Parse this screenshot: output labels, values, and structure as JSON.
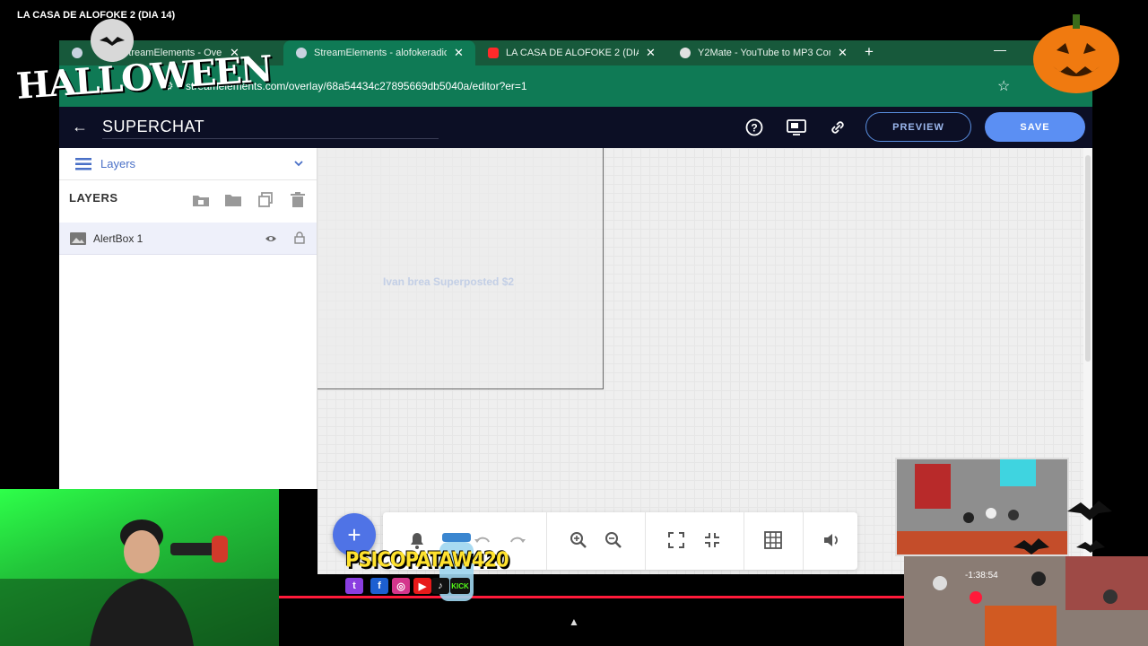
{
  "stream_title": "LA CASA DE ALOFOKE 2 (DIA 14)",
  "browser": {
    "tabs": [
      {
        "label": "StreamElements - Overlays",
        "icon": "streamelements-icon"
      },
      {
        "label": "StreamElements - alofokeradio",
        "icon": "streamelements-icon"
      },
      {
        "label": "LA CASA DE ALOFOKE 2 (DIA 14)",
        "icon": "youtube-icon"
      },
      {
        "label": "Y2Mate - YouTube to MP3 Converter",
        "icon": "y2mate-icon"
      }
    ],
    "url": "streamelements.com/overlay/68a54434c27895669db5040a/editor?er=1"
  },
  "editor": {
    "title": "SUPERCHAT",
    "preview_label": "PREVIEW",
    "save_label": "SAVE"
  },
  "panel": {
    "section_title": "Layers",
    "layers_heading": "LAYERS",
    "layers": [
      {
        "name": "AlertBox 1"
      }
    ]
  },
  "canvas": {
    "alert_text": "Ivan brea Superposted $2"
  },
  "overlay": {
    "halloween_text": "HALLOWEEN",
    "brand_name": "PSICOPATAW420",
    "timecode": "-1:38:54",
    "socials": [
      "twitch",
      "facebook",
      "instagram",
      "youtube",
      "tiktok",
      "kick"
    ],
    "kick_label": "KICK"
  },
  "colors": {
    "tabbar": "#17593b",
    "addressbar": "#0f7a55",
    "header": "#0c0f25",
    "accent": "#5b8ff3",
    "progress": "#ff1a3a"
  }
}
